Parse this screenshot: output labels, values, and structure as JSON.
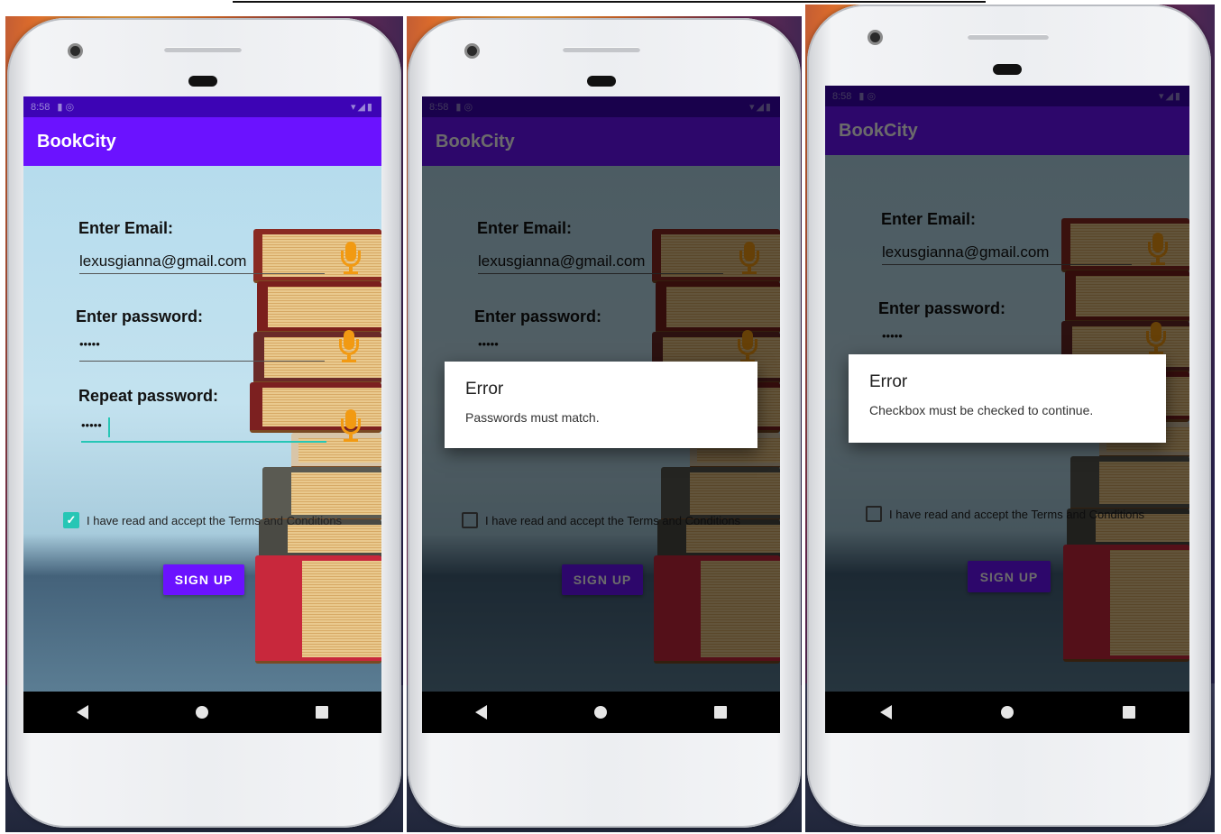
{
  "app": {
    "title": "BookCity",
    "status_time": "8:58"
  },
  "form": {
    "email_label": "Enter Email:",
    "email_value": "lexusgianna@gmail.com",
    "password_label": "Enter password:",
    "password_value": "•••••",
    "repeat_label": "Repeat password:",
    "repeat_value": "•••••",
    "terms_label": "I have read and accept the Terms and Conditions",
    "signup_label": "SIGN UP"
  },
  "screens": [
    {
      "terms_checked": true,
      "dialog": null
    },
    {
      "terms_checked": false,
      "dialog": {
        "title": "Error",
        "message": "Passwords must match."
      }
    },
    {
      "terms_checked": false,
      "dialog": {
        "title": "Error",
        "message": "Checkbox must be checked to continue."
      }
    }
  ],
  "dialogs": {
    "d1": {
      "title": "Error",
      "message": "Passwords must match."
    },
    "d2": {
      "title": "Error",
      "message": "Checkbox must be checked to continue."
    }
  },
  "colors": {
    "primary": "#6b12ff",
    "status_bar": "#3d04b5",
    "accent": "#26c6b5",
    "mic": "#f29a12"
  }
}
